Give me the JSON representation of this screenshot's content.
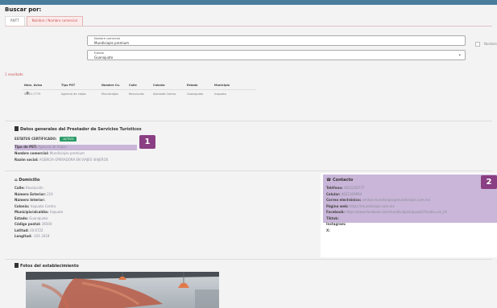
{
  "header": {
    "title": "Buscar por:"
  },
  "tabs": [
    {
      "label": "RNTT"
    },
    {
      "label": "Nombre / Nombre comercial"
    }
  ],
  "search": {
    "name_field": {
      "label": "Nombre comercial",
      "value": "Mundiviajes premium"
    },
    "state_field": {
      "label": "Estado",
      "value": "Guanajuato"
    },
    "side_label": "Nombre"
  },
  "results": {
    "label": "1 resultado",
    "columns": [
      "Núm. Aviso",
      "Tipo PST",
      "Nombre Co.",
      "Calle",
      "Colonia",
      "Estado",
      "Municipio"
    ],
    "rows": [
      [
        "04-01-7775",
        "Agencia de viajes",
        "Mundiviajes",
        "Revolución",
        "Alameda Centro",
        "Guanajuato",
        "Irapuato"
      ]
    ]
  },
  "general": {
    "heading": "Datos generales del Prestador de Servicios Turísticos",
    "status_label": "ESTATUS CERTIFICADO:",
    "status_value": "ACTIVO",
    "status_color": "#2f9c6a",
    "fields": [
      {
        "k": "Tipo de PST:",
        "v": "Agencia de Viajes",
        "highlight": true
      },
      {
        "k": "Nombre comercial:",
        "v": "Mundiviajes premium",
        "highlight": false
      },
      {
        "k": "Razón social:",
        "v": "AGENCIA OPERADORA EN VIAJES VIAJEROS",
        "highlight": false
      }
    ]
  },
  "domicilio": {
    "heading": "Domicilio",
    "fields": [
      {
        "k": "Calle:",
        "v": "Revolución"
      },
      {
        "k": "Número Exterior:",
        "v": "210"
      },
      {
        "k": "Número Interior:",
        "v": ""
      },
      {
        "k": "Colonia:",
        "v": "Irapuato Centro"
      },
      {
        "k": "Municipio/alcaldía:",
        "v": "Irapuato"
      },
      {
        "k": "Estado:",
        "v": "Guanajuato"
      },
      {
        "k": "Código postal:",
        "v": "36500"
      },
      {
        "k": "Latitud:",
        "v": "20.6722"
      },
      {
        "k": "Longitud:",
        "v": "-101.3418"
      }
    ]
  },
  "contacto": {
    "heading": "Contacto",
    "fields": [
      {
        "k": "Teléfono:",
        "v": "4621256777"
      },
      {
        "k": "Celular:",
        "v": "4621309994"
      },
      {
        "k": "Correo electrónico:",
        "v": "ventas.mundiviajes@mundiviajes.com.mx"
      },
      {
        "k": "Página web:",
        "v": "https://mundiviajes.com.mx"
      },
      {
        "k": "Facebook:",
        "v": "https://www.facebook.com/mundiviajesirapuato/?locale=es_LA"
      },
      {
        "k": "Tiktok:",
        "v": ""
      },
      {
        "k": "Instagram:",
        "v": ""
      },
      {
        "k": "X:",
        "v": ""
      }
    ]
  },
  "fotos": {
    "heading": "Fotos del establecimiento"
  },
  "badges": {
    "one": "1",
    "two": "2",
    "color": "#8a3e83"
  }
}
